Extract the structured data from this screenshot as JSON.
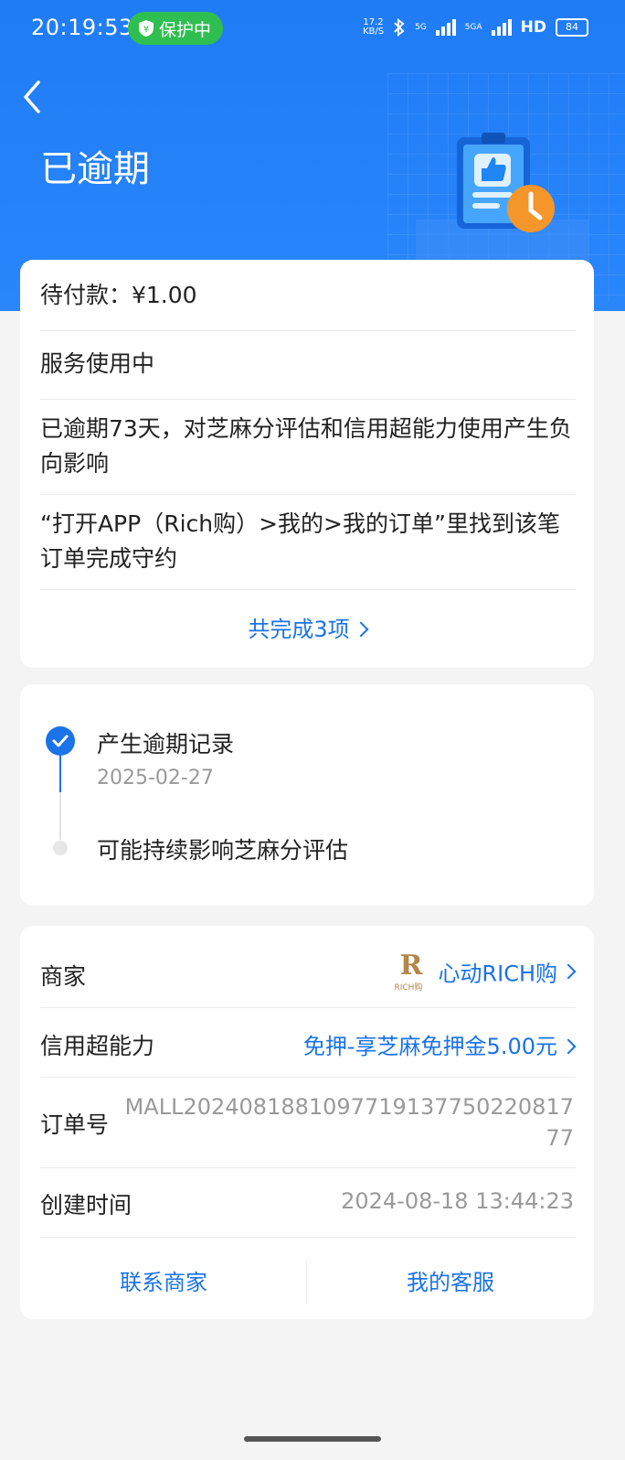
{
  "status_bar": {
    "time": "20:19:53",
    "protect_label": "保护中",
    "net_speed_value": "17.2",
    "net_speed_unit": "KB/S",
    "signal_1": "5G",
    "signal_2": "5GA",
    "hd_label": "HD",
    "battery": "84"
  },
  "header": {
    "title": "已逾期",
    "back_icon": "chevron-left-icon",
    "colors": {
      "header_blue": "#1f7cf5",
      "link_blue": "#1a73e8",
      "pill_green": "#2fbf50"
    }
  },
  "summary_card": {
    "amount_due": "待付款：¥1.00",
    "service_status": "服务使用中",
    "overdue_note": "已逾期73天，对芝麻分评估和信用超能力使用产生负向影响",
    "instruction": "“打开APP（Rich购）>我的>我的订单”里找到该笔订单完成守约",
    "complete_link": "共完成3项"
  },
  "timeline": {
    "events": [
      {
        "title": "产生逾期记录",
        "date": "2025-02-27",
        "done": true
      },
      {
        "title": "可能持续影响芝麻分评估",
        "done": false
      }
    ]
  },
  "details": {
    "merchant_label": "商家",
    "merchant_name": "心动RICH购",
    "merchant_logo_letter": "R",
    "merchant_logo_text": "RICH购",
    "credit_label": "信用超能力",
    "credit_value": "免押-享芝麻免押金5.00元",
    "order_label": "订单号",
    "order_value": "MALL2024081881097719137750220817 77",
    "created_label": "创建时间",
    "created_value": "2024-08-18 13:44:23",
    "contact_merchant": "联系商家",
    "customer_service": "我的客服"
  }
}
